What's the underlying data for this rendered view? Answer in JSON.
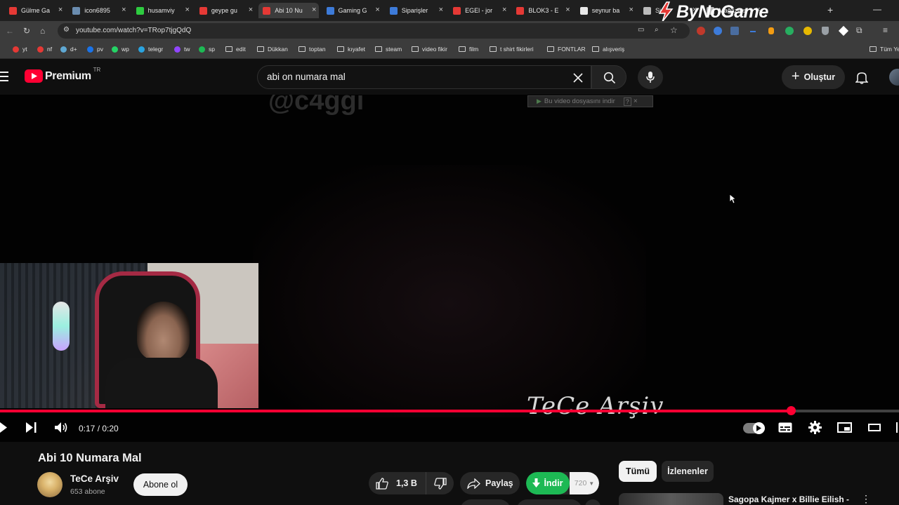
{
  "tabs": [
    {
      "title": "Gülme Ga",
      "color": "#e53935"
    },
    {
      "title": "icon6895",
      "color": "#6a8caf"
    },
    {
      "title": "husamviy",
      "color": "#2ecc40"
    },
    {
      "title": "geype gu",
      "color": "#e53935"
    },
    {
      "title": "Abi 10 Nu",
      "color": "#e53935"
    },
    {
      "title": "Gaming G",
      "color": "#3d7bd9"
    },
    {
      "title": "Siparişler",
      "color": "#3d7bd9"
    },
    {
      "title": "EGEl - jor",
      "color": "#e53935"
    },
    {
      "title": "BLOK3 - E",
      "color": "#e53935"
    },
    {
      "title": "seynur ba",
      "color": "#e8e8e8"
    },
    {
      "title": "Si",
      "color": "#bbbbbb"
    },
    {
      "title": "Mağaza s",
      "color": "#bbbbbb"
    }
  ],
  "watermark": "ByNoGame",
  "address": {
    "url": "youtube.com/watch?v=TRop7tjgQdQ"
  },
  "bookmarks": [
    {
      "label": "yt",
      "type": "site",
      "color": "#e53935"
    },
    {
      "label": "nf",
      "type": "site",
      "color": "#e53935"
    },
    {
      "label": "d+",
      "type": "site",
      "color": "#5fa8d3"
    },
    {
      "label": "pv",
      "type": "site",
      "color": "#1a73e8"
    },
    {
      "label": "wp",
      "type": "site",
      "color": "#25d366"
    },
    {
      "label": "telegr",
      "type": "site",
      "color": "#2aa3df"
    },
    {
      "label": "tw",
      "type": "site",
      "color": "#9146ff"
    },
    {
      "label": "sp",
      "type": "site",
      "color": "#1db954"
    },
    {
      "label": "edit",
      "type": "folder"
    },
    {
      "label": "Dükkan",
      "type": "folder"
    },
    {
      "label": "toptan",
      "type": "folder"
    },
    {
      "label": "kıyafet",
      "type": "folder"
    },
    {
      "label": "steam",
      "type": "folder"
    },
    {
      "label": "video fikir",
      "type": "folder"
    },
    {
      "label": "film",
      "type": "folder"
    },
    {
      "label": "t shirt fikirleri",
      "type": "folder"
    },
    {
      "label": "FONTLAR",
      "type": "folder"
    },
    {
      "label": "alışveriş",
      "type": "folder"
    }
  ],
  "all_bookmarks_label": "Tüm Ye",
  "youtube": {
    "logo_text": "Premium",
    "logo_region": "TR",
    "search_value": "abi on numara mal",
    "create_label": "Oluştur"
  },
  "video": {
    "overlay_handle": "@c4ggi",
    "download_bar_label": "Bu video dosyasını indir",
    "download_bar_count": "?",
    "watermark_text": "TeCe Arşiv",
    "time_current": "0:17",
    "time_sep": " / ",
    "time_total": "0:20",
    "progress_fraction": 0.88
  },
  "info": {
    "title": "Abi 10 Numara Mal",
    "channel_name": "TeCe Arşiv",
    "subscribers": "653 abone",
    "subscribe_label": "Abone ol",
    "likes": "1,3 B",
    "share_label": "Paylaş",
    "download_label": "İndir",
    "download_quality": "720",
    "chip_all": "Tümü",
    "chip_watched": "İzlenenler",
    "next_video_title": "Sagopa Kajmer x Billie Eilish -"
  },
  "colors": {
    "accent": "#ff0033",
    "download_green": "#1db954"
  }
}
